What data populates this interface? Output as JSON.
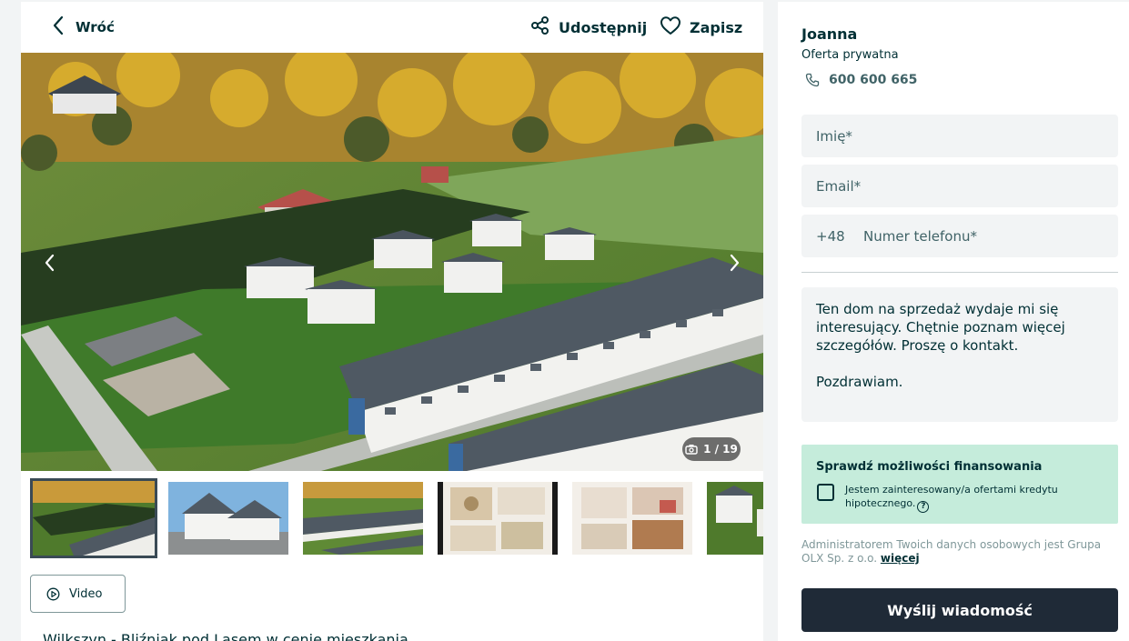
{
  "header": {
    "back_label": "Wróć",
    "share_label": "Udostępnij",
    "save_label": "Zapisz"
  },
  "gallery": {
    "counter": "1 / 19",
    "thumbnail_count_visible": 6
  },
  "video_button_label": "Video",
  "listing_title": "Wilkszyn - Bliźniak pod Lasem w cenie mieszkania",
  "seller": {
    "name": "Joanna",
    "type": "Oferta prywatna",
    "phone": "600 600 665"
  },
  "form": {
    "name_placeholder": "Imię*",
    "email_placeholder": "Email*",
    "phone_prefix": "+48",
    "phone_placeholder": "Numer telefonu*",
    "message": "Ten dom na sprzedaż wydaje mi się interesujący. Chętnie poznam więcej szczegółów. Proszę o kontakt.\n\nPozdrawiam."
  },
  "financing": {
    "title": "Sprawdź możliwości finansowania",
    "checkbox_label": "Jestem zainteresowany/a ofertami kredytu hipotecznego.",
    "checked": false
  },
  "gdpr": {
    "text": "Administratorem Twoich danych osobowych jest Grupa OLX Sp. z o.o.",
    "more_label": "więcej"
  },
  "send_button_label": "Wyślij wiadomość",
  "colors": {
    "accent_dark": "#1f2a37",
    "financing_bg": "#c5ecdb",
    "field_bg": "#f2f4f5"
  }
}
